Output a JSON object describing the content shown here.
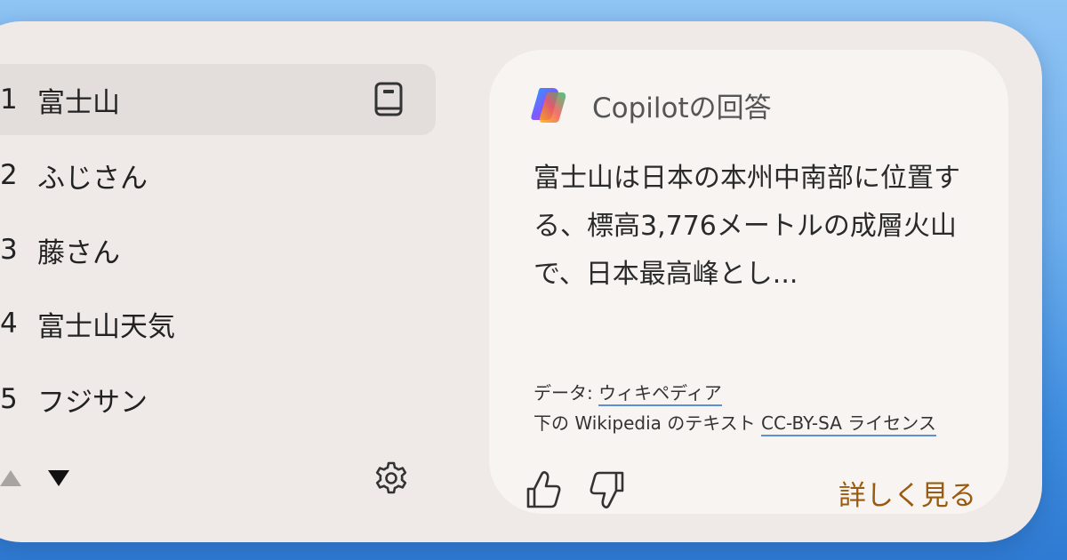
{
  "suggestions": [
    {
      "num": "1",
      "text": "富士山"
    },
    {
      "num": "2",
      "text": "ふじさん"
    },
    {
      "num": "3",
      "text": "藤さん"
    },
    {
      "num": "4",
      "text": "富士山天気"
    },
    {
      "num": "5",
      "text": "フジサン"
    }
  ],
  "card": {
    "title": "Copilotの回答",
    "answer": "富士山は日本の本州中南部に位置する、標高3,776メートルの成層火山で、日本最高峰とし...",
    "source_prefix": "データ: ",
    "source_link": "ウィキペディア",
    "license_prefix": "下の Wikipedia のテキスト ",
    "license_link": "CC-BY-SA ライセンス",
    "more_label": "詳しく見る"
  },
  "icons": {
    "book": "book-icon",
    "settings": "gear-icon",
    "prev": "triangle-up-icon",
    "next": "triangle-down-icon",
    "copilot": "copilot-logo-icon",
    "like": "thumbs-up-icon",
    "dislike": "thumbs-down-icon"
  },
  "colors": {
    "panel": "#efeae8",
    "card": "#f7f4f2",
    "selected_row": "#e3dddb",
    "accent_link": "#9a5b10",
    "link_underline": "#5b8fd6"
  }
}
